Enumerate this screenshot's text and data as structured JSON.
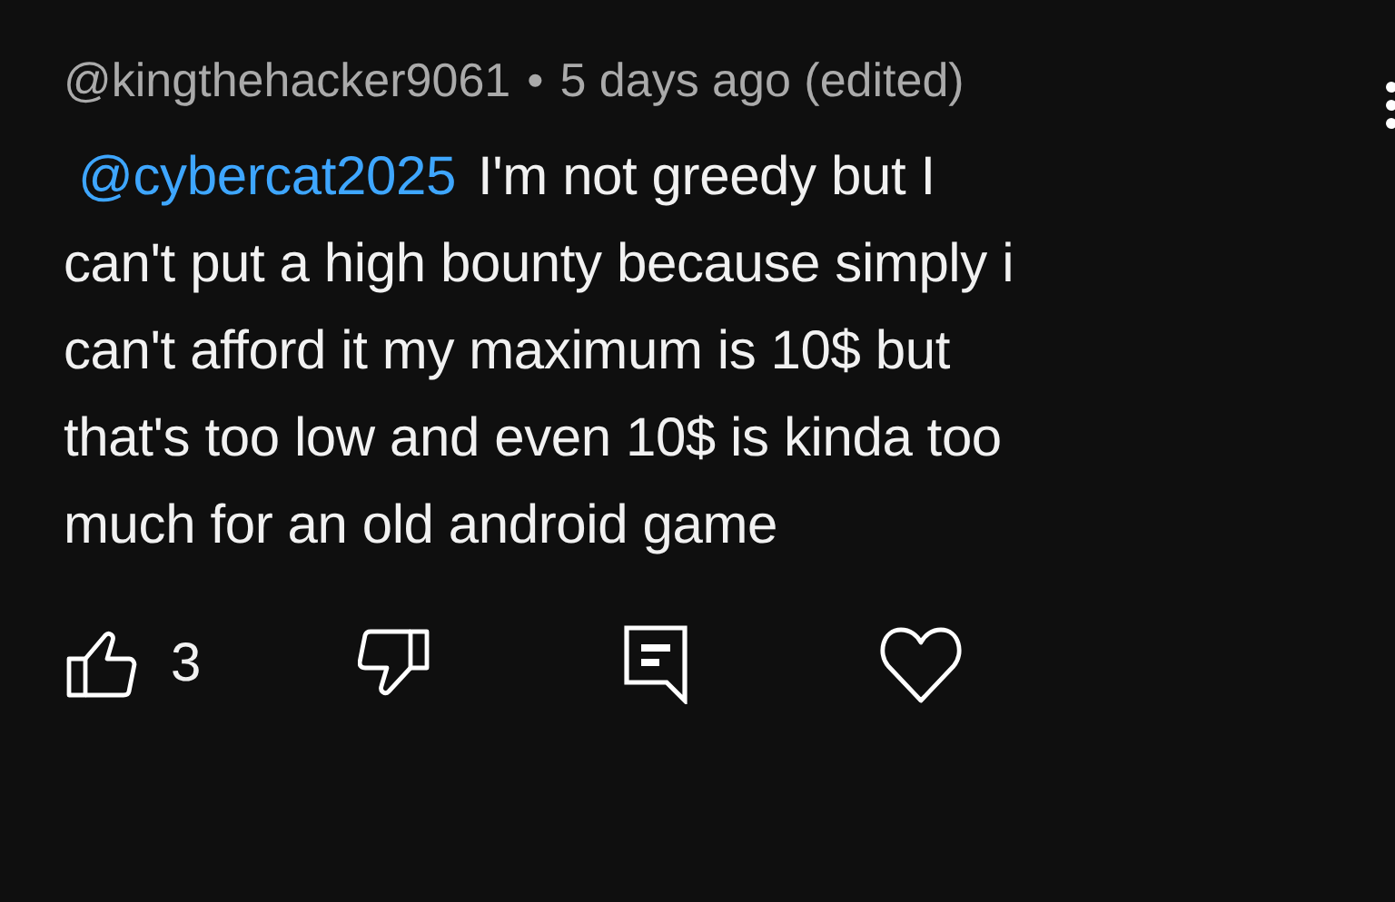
{
  "comment": {
    "author": "@kingthehacker9061",
    "separator": "•",
    "time": "5 days ago (edited)",
    "mention": "@cybercat2025",
    "lines": [
      "I'm not greedy but I",
      "can't put a high bounty because simply i",
      "can't afford it my maximum is 10$ but",
      "that's too low and even 10$ is kinda too",
      "much for an old android game"
    ]
  },
  "actions": {
    "like_count": "3"
  }
}
